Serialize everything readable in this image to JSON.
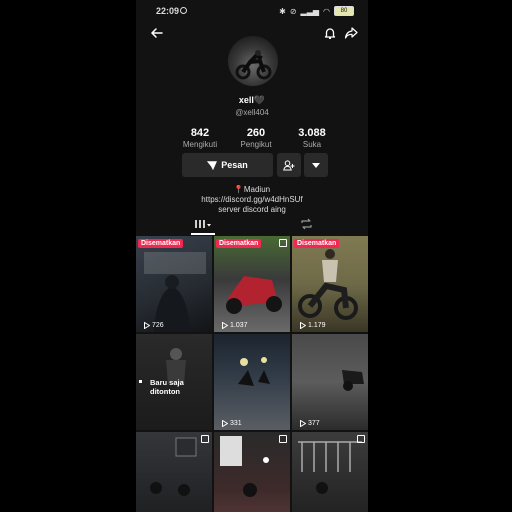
{
  "status_bar": {
    "time": "22:09",
    "battery": "80"
  },
  "profile": {
    "username": "xell🖤",
    "handle": "@xell404",
    "stats": [
      {
        "value": "842",
        "label": "Mengikuti"
      },
      {
        "value": "260",
        "label": "Pengikut"
      },
      {
        "value": "3.088",
        "label": "Suka"
      }
    ],
    "message_button": "Pesan",
    "location": "Madiun",
    "link": "https://discord.gg/w4dHnSUf",
    "bio_line": "server discord aing"
  },
  "videos": [
    {
      "pinned": true,
      "pinned_label": "Disematkan",
      "views": "726",
      "colors": [
        "#2a3038",
        "#4e5660"
      ]
    },
    {
      "pinned": true,
      "pinned_label": "Disematkan",
      "views": "1.037",
      "colors": [
        "#3f5a2c",
        "#7a2130"
      ]
    },
    {
      "pinned": true,
      "pinned_label": "Disematkan",
      "views": "1.179",
      "colors": [
        "#6e6a48",
        "#2c2a22"
      ]
    },
    {
      "pinned": false,
      "label": "Baru saja\nditonton",
      "colors": [
        "#1c1c1c",
        "#3c3c3c"
      ]
    },
    {
      "pinned": false,
      "views": "331",
      "colors": [
        "#24303c",
        "#5a5e64"
      ]
    },
    {
      "pinned": false,
      "views": "377",
      "colors": [
        "#555",
        "#2e2e2e"
      ]
    },
    {
      "pinned": false,
      "colors": [
        "#323438",
        "#1a1c1e"
      ]
    },
    {
      "pinned": false,
      "colors": [
        "#2a2a2a",
        "#5b3a3a"
      ]
    },
    {
      "pinned": false,
      "colors": [
        "#3c3c3c",
        "#1e1e1e"
      ]
    }
  ]
}
